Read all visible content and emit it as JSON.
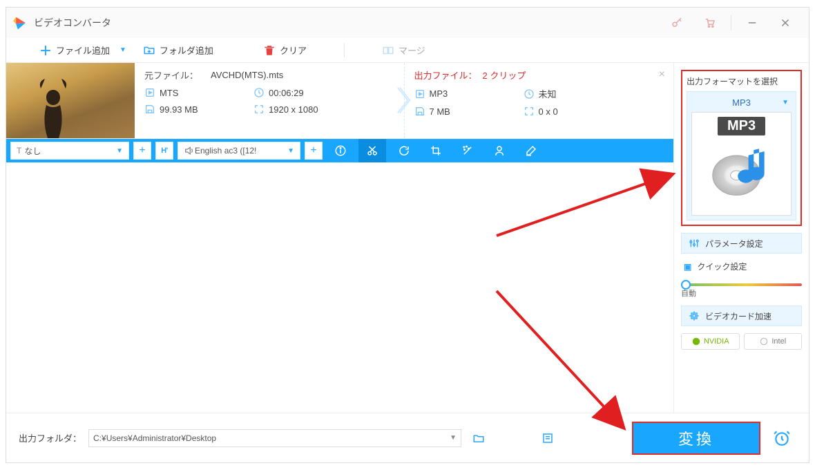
{
  "app": {
    "title": "ビデオコンバータ"
  },
  "toolbar": {
    "add_file": "ファイル追加",
    "add_folder": "フォルダ追加",
    "clear": "クリア",
    "merge": "マージ"
  },
  "item": {
    "source": {
      "label": "元ファイル：",
      "filename": "AVCHD(MTS).mts",
      "format": "MTS",
      "duration": "00:06:29",
      "size": "99.93 MB",
      "resolution": "1920 x 1080"
    },
    "output": {
      "label": "出力ファイル：",
      "clips": "2 クリップ",
      "format": "MP3",
      "duration": "未知",
      "size": "7 MB",
      "resolution": "0 x 0"
    },
    "subs": {
      "prefix": "T",
      "value": "なし"
    },
    "add_sub_btn": "+",
    "hbtn": "H'",
    "audio_value": "English ac3 ([12!",
    "add_aud_btn": "+"
  },
  "right": {
    "select_format_label": "出力フォーマットを選択",
    "format_name": "MP3",
    "mp3_badge": "MP3",
    "param_settings": "パラメータ設定",
    "quick_settings": "クイック設定",
    "slider_label": "自動",
    "gpu_accel": "ビデオカード加速",
    "nvidia": "NVIDIA",
    "intel": "Intel"
  },
  "bottom": {
    "output_folder_label": "出力フォルダ：",
    "path": "C:¥Users¥Administrator¥Desktop",
    "convert": "変換"
  }
}
